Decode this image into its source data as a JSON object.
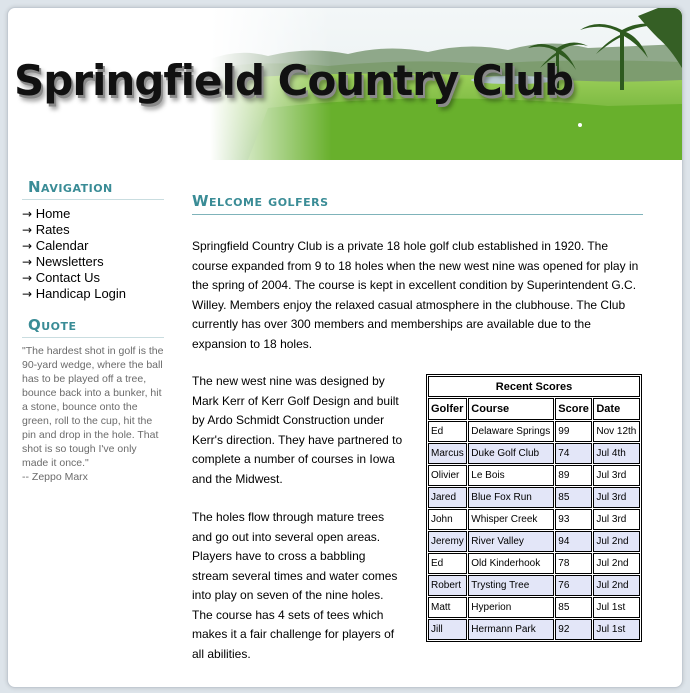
{
  "site": {
    "title": "Springfield Country Club"
  },
  "sidebar": {
    "nav_heading": "Navigation",
    "nav_items": [
      {
        "label": "Home"
      },
      {
        "label": "Rates"
      },
      {
        "label": "Calendar"
      },
      {
        "label": "Newsletters"
      },
      {
        "label": "Contact Us"
      },
      {
        "label": "Handicap Login"
      }
    ],
    "quote_heading": "Quote",
    "quote_text": "\"The hardest shot in golf is the 90-yard wedge, where the ball has to be played off a tree, bounce back into a bunker, hit a stone, bounce onto the green, roll to the cup, hit the pin and drop in the hole. That shot is so tough I've only made it once.\"",
    "quote_author": "-- Zeppo Marx"
  },
  "main": {
    "heading": "Welcome golfers",
    "intro": "Springfield Country Club is a private 18 hole golf club established in 1920. The course expanded from 9 to 18 holes when the new west nine was opened for play in the spring of 2004. The course is kept in excellent condition by Superintendent G.C. Willey. Members enjoy the relaxed casual atmosphere in the clubhouse. The Club currently has over 300 members and memberships are available due to the expansion to 18 holes.",
    "para2": "The new west nine was designed by Mark Kerr of Kerr Golf Design and built by Ardo Schmidt Construction under Kerr's direction. They have partnered to complete a number of courses in Iowa and the Midwest.",
    "para3": "The holes flow through mature trees and go out into several open areas. Players have to cross a babbling stream several times and water comes into play on seven of the nine holes. The course has 4 sets of tees which makes it a fair challenge for players of all abilities."
  },
  "scores": {
    "title": "Recent Scores",
    "headers": [
      "Golfer",
      "Course",
      "Score",
      "Date"
    ],
    "rows": [
      [
        "Ed",
        "Delaware Springs",
        "99",
        "Nov 12th"
      ],
      [
        "Marcus",
        "Duke Golf Club",
        "74",
        "Jul 4th"
      ],
      [
        "Olivier",
        "Le Bois",
        "89",
        "Jul 3rd"
      ],
      [
        "Jared",
        "Blue Fox Run",
        "85",
        "Jul 3rd"
      ],
      [
        "John",
        "Whisper Creek",
        "93",
        "Jul 3rd"
      ],
      [
        "Jeremy",
        "River Valley",
        "94",
        "Jul 2nd"
      ],
      [
        "Ed",
        "Old Kinderhook",
        "78",
        "Jul 2nd"
      ],
      [
        "Robert",
        "Trysting Tree",
        "76",
        "Jul 2nd"
      ],
      [
        "Matt",
        "Hyperion",
        "85",
        "Jul 1st"
      ],
      [
        "Jill",
        "Hermann Park",
        "92",
        "Jul 1st"
      ]
    ]
  },
  "colors": {
    "accent": "#3a8c96",
    "alt_row": "#e3e6f8",
    "quote_text": "#6b6b6b"
  }
}
